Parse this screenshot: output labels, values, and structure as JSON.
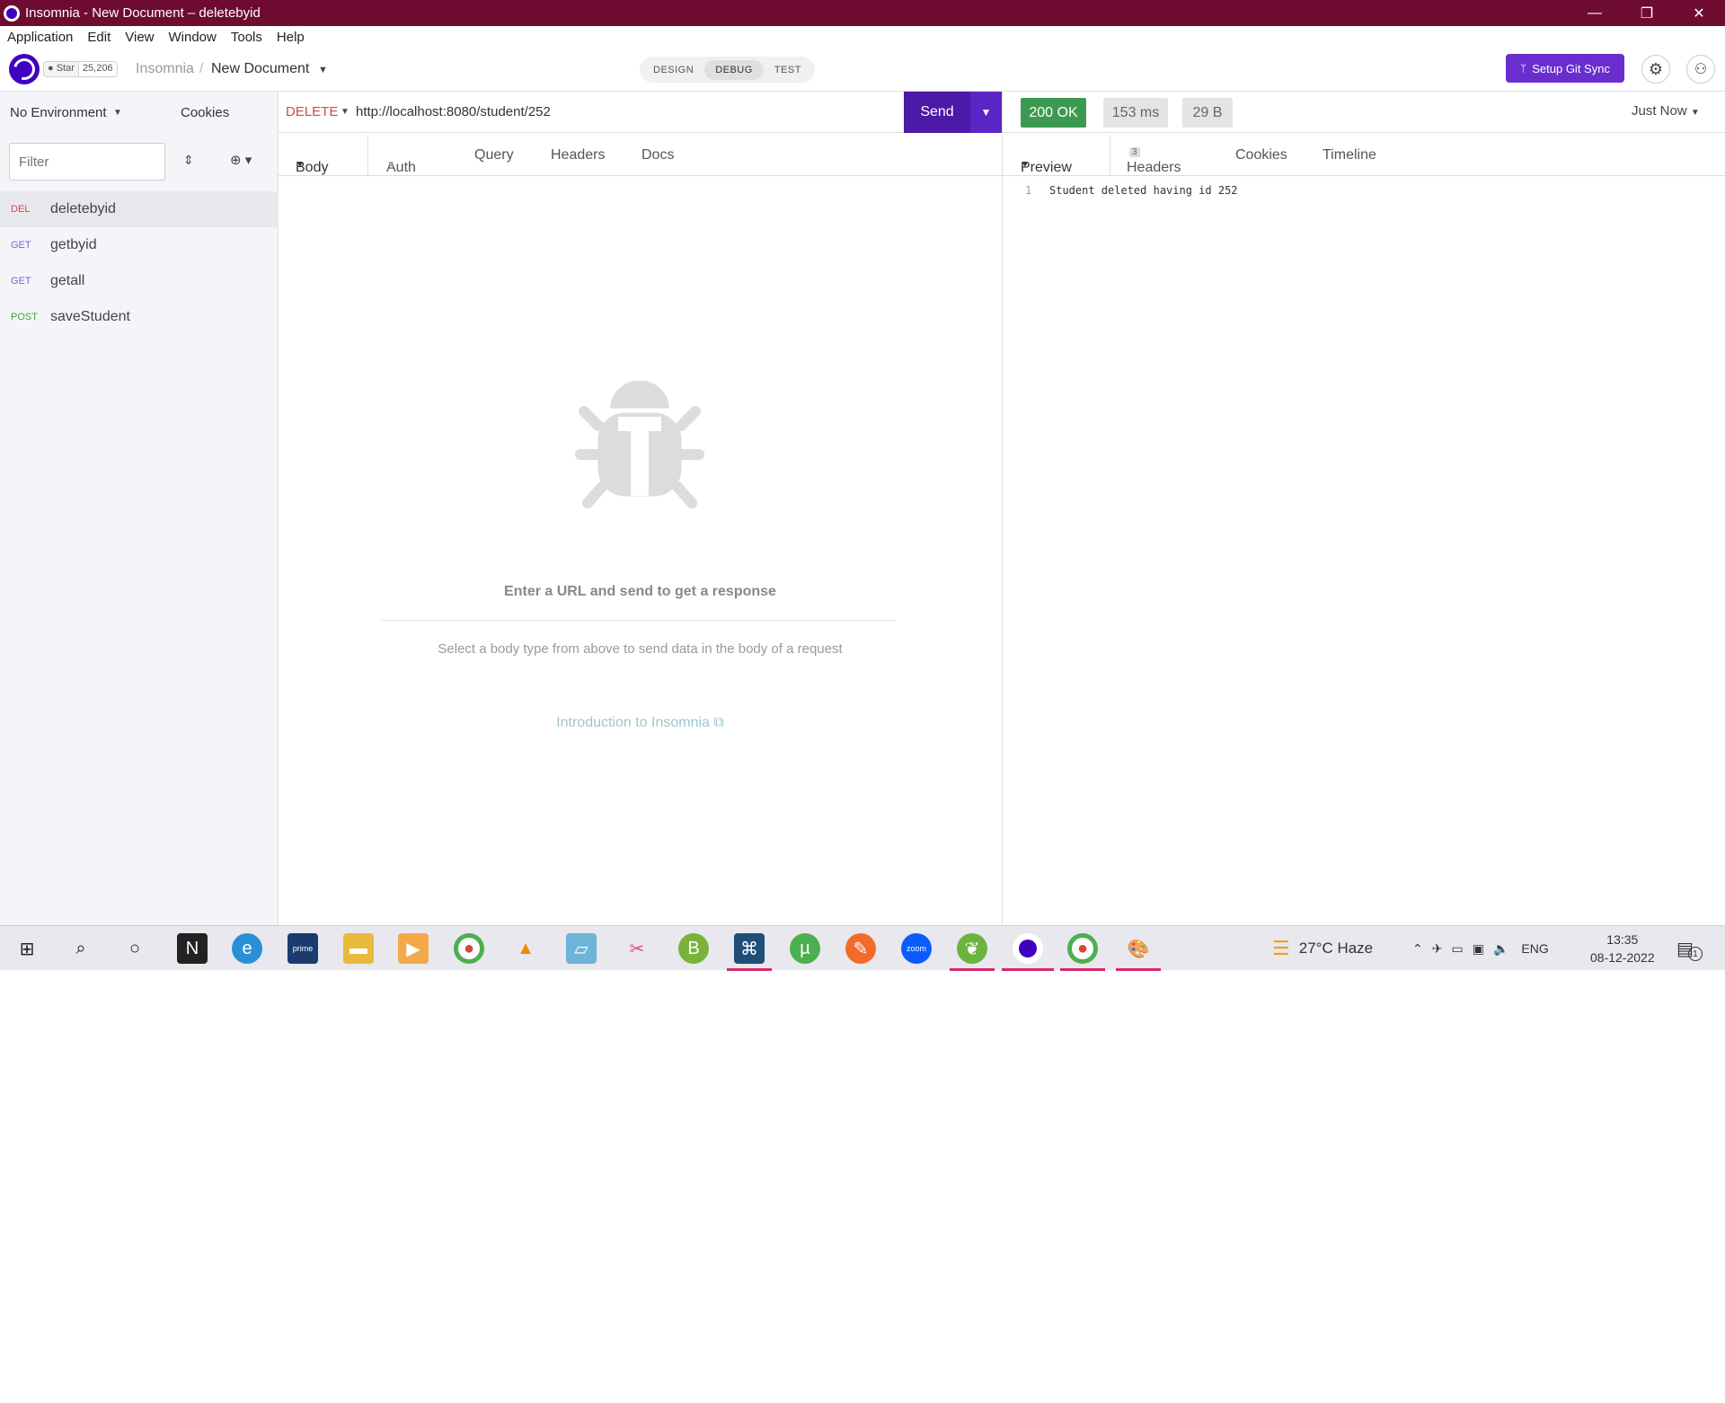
{
  "window": {
    "title": "Insomnia - New Document – deletebyid",
    "minimize": "—",
    "restore": "❐",
    "close": "✕"
  },
  "menu": [
    "Application",
    "Edit",
    "View",
    "Window",
    "Tools",
    "Help"
  ],
  "header": {
    "star_label": "Star",
    "star_count": "25,206",
    "crumb_root": "Insomnia",
    "crumb_sep": "/",
    "crumb_doc": "New Document",
    "modes": [
      "DESIGN",
      "DEBUG",
      "TEST"
    ],
    "active_mode": "DEBUG",
    "git_sync_label": "Setup Git Sync"
  },
  "sidebar": {
    "environment": "No Environment",
    "cookies_label": "Cookies",
    "filter_placeholder": "Filter",
    "requests": [
      {
        "method": "DEL",
        "name": "deletebyid",
        "color": "#d24a4a",
        "active": true
      },
      {
        "method": "GET",
        "name": "getbyid",
        "color": "#7563c9",
        "active": false
      },
      {
        "method": "GET",
        "name": "getall",
        "color": "#7563c9",
        "active": false
      },
      {
        "method": "POST",
        "name": "saveStudent",
        "color": "#4a9a3e",
        "active": false
      }
    ]
  },
  "request": {
    "method": "DELETE",
    "method_color": "#d24a4a",
    "url": "http://localhost:8080/student/252",
    "send_label": "Send",
    "tabs": [
      "Body",
      "Auth",
      "Query",
      "Headers",
      "Docs"
    ],
    "empty_title": "Enter a URL and send to get a response",
    "empty_sub": "Select a body type from above to send data in the body of a request",
    "intro_link": "Introduction to Insomnia"
  },
  "response": {
    "status": "200 OK",
    "status_color": "#3c9a50",
    "time": "153 ms",
    "size": "29 B",
    "when": "Just Now",
    "tabs": [
      "Preview",
      "Headers",
      "Cookies",
      "Timeline"
    ],
    "headers_count": "3",
    "lines": [
      {
        "num": "1",
        "text": "Student deleted having id 252"
      }
    ]
  },
  "taskbar": {
    "weather": "27°C  Haze",
    "lang": "ENG",
    "time": "13:35",
    "date": "08-12-2022",
    "notifications": "1"
  },
  "colors": {
    "titlebar": "#6d0c30",
    "accent": "#4000bf",
    "git_button": "#6a2ecf"
  }
}
